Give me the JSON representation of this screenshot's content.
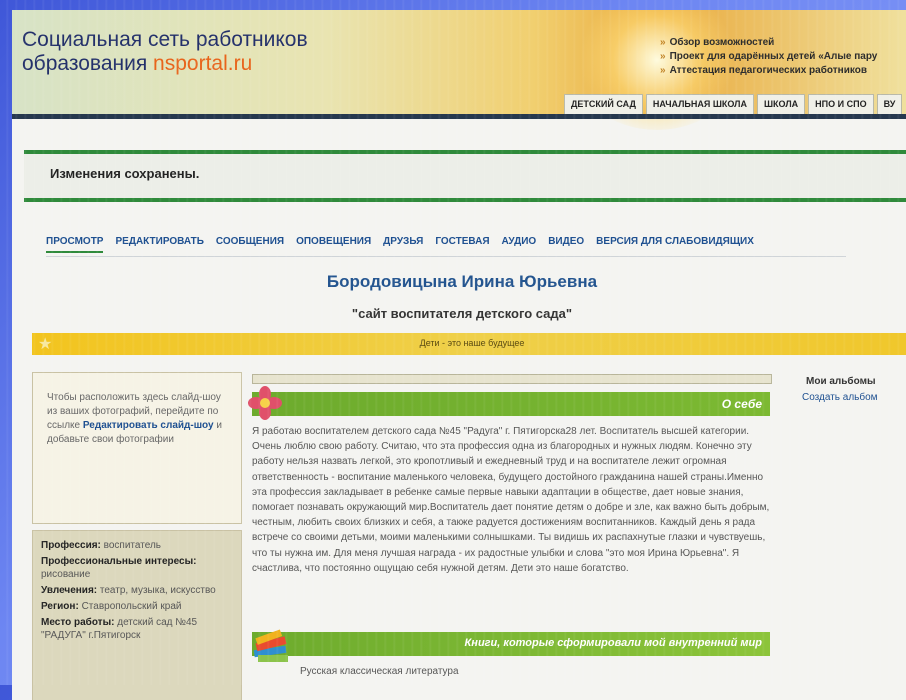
{
  "header": {
    "title_line1": "Социальная сеть работников",
    "title_line2": "образования",
    "brand": "nsportal.ru",
    "links": [
      "Обзор возможностей",
      "Проект для одарённых детей «Алые пару",
      "Аттестация педагогических работников"
    ],
    "nav_tabs": [
      "ДЕТСКИЙ САД",
      "НАЧАЛЬНАЯ ШКОЛА",
      "ШКОЛА",
      "НПО И СПО",
      "ВУ"
    ]
  },
  "notice": "Изменения сохранены.",
  "profile_tabs": [
    "ПРОСМОТР",
    "РЕДАКТИРОВАТЬ",
    "СООБЩЕНИЯ",
    "ОПОВЕЩЕНИЯ",
    "ДРУЗЬЯ",
    "ГОСТЕВАЯ",
    "АУДИО",
    "ВИДЕО",
    "ВЕРСИЯ ДЛЯ СЛАБОВИДЯЩИХ"
  ],
  "user_name": "Бородовицына Ирина Юрьевна",
  "site_title": "\"сайт воспитателя детского сада\"",
  "motto": "Дети - это наше будущее",
  "slideshow": {
    "text1": "Чтобы расположить здесь слайд-шоу из ваших фотографий, перейдите по ссылке",
    "link": "Редактировать слайд-шоу",
    "text2": "и добавьте свои фотографии"
  },
  "info": [
    {
      "key": "Профессия:",
      "value": "воспитатель"
    },
    {
      "key": "Профессиональные интересы:",
      "value": "рисование"
    },
    {
      "key": "Увлечения:",
      "value": "театр, музыка, искусство"
    },
    {
      "key": "Регион:",
      "value": "Ставропольский край"
    },
    {
      "key": "Место работы:",
      "value": "детский сад №45 \"РАДУГА\" г.Пятигорск"
    }
  ],
  "about": {
    "heading": "О себе",
    "text": "Я работаю воспитателем детского сада №45 \"Радуга\" г. Пятигорска28 лет. Воспитатель высшей категории. Очень люблю свою работу. Считаю, что эта профессия одна из благородных и нужных людям. Конечно эту работу нельзя назвать легкой, это кропотливый и ежедневный труд и на воспитателе лежит огромная ответственность - воспитание маленького человека, будущего достойного гражданина нашей страны.Именно эта профессия закладывает в ребенке самые первые навыки адаптации в обществе, дает новые знания, помогает познавать окружающий мир.Воспитатель дает понятие детям о добре и зле, как важно быть добрым, честным, любить своих близких и себя, а также радуется достижениям воспитанников. Каждый день я рада встрече со своими детьми, моими маленькими солнышками.  Ты видишь их распахнутые глазки и чувствуешь, что ты нужна им.  Для меня лучшая награда - их радостные улыбки и слова \"это моя Ирина Юрьевна\". Я счастлива, что постоянно ощущаю себя нужной детям. Дети это наше богатство."
  },
  "books": {
    "heading": "Книги, которые сформировали мой внутренний мир",
    "item": "Русская классическая литература"
  },
  "albums": {
    "title": "Мои альбомы",
    "create": "Создать альбом"
  }
}
